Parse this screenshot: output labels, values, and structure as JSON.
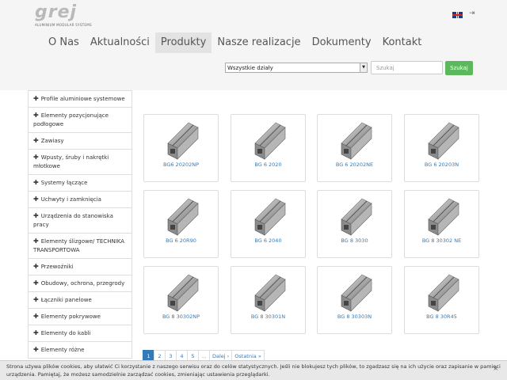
{
  "brand": {
    "logo_text": "grej",
    "logo_sub": "ALUMINIUM MODULAR SYSTEMS"
  },
  "nav": {
    "items": [
      "O Nas",
      "Aktualności",
      "Produkty",
      "Nasze realizacje",
      "Dokumenty",
      "Kontakt"
    ],
    "active": "Produkty"
  },
  "search": {
    "category": "Wszystkie działy",
    "placeholder": "Szukaj",
    "button": "Szukaj"
  },
  "sidebar": {
    "items": [
      "Profile aluminiowe systemowe",
      "Elementy pozycjonujące podłogowe",
      "Zawiasy",
      "Wpusty, śruby i nakrętki młotkowe",
      "Systemy łączące",
      "Uchwyty i zamknięcia",
      "Urządzenia do stanowiska pracy",
      "Elementy ślizgowe/ TECHNIKA TRANSPORTOWA",
      "Przewoźniki",
      "Obudowy, ochrona, przegrody",
      "Łączniki panelowe",
      "Elementy pokrywowe",
      "Elementy do kabli",
      "Elementy różne"
    ]
  },
  "products": [
    {
      "label": "BG6 20202NP",
      "icon": "aluminum-profile-icon"
    },
    {
      "label": "BG 6 2020",
      "icon": "aluminum-profile-icon"
    },
    {
      "label": "BG 6 20202NE",
      "icon": "aluminum-profile-icon"
    },
    {
      "label": "BG 6 20203N",
      "icon": "aluminum-profile-icon"
    },
    {
      "label": "BG 6 20R90",
      "icon": "aluminum-profile-icon"
    },
    {
      "label": "BG 6 2040",
      "icon": "aluminum-profile-icon"
    },
    {
      "label": "BG 8 3030",
      "icon": "aluminum-profile-icon"
    },
    {
      "label": "BG 8 30302 NE",
      "icon": "aluminum-profile-icon"
    },
    {
      "label": "BG 8 30302NP",
      "icon": "aluminum-profile-icon"
    },
    {
      "label": "BG 8 30301N",
      "icon": "aluminum-profile-icon"
    },
    {
      "label": "BG 8 30303N",
      "icon": "aluminum-profile-icon"
    },
    {
      "label": "BG 8 30R45",
      "icon": "aluminum-profile-icon"
    }
  ],
  "pagination": {
    "pages": [
      "1",
      "2",
      "3",
      "4",
      "5",
      "...",
      "Dalej ›",
      "Ostatnia »"
    ],
    "current": "1"
  },
  "cookie": {
    "text": "Strona używa plików cookies, aby ułatwić Ci korzystanie z naszego serwisu oraz do celów statystycznych. Jeśli nie blokujesz tych plików, to zgadzasz się na ich użycie oraz zapisanie w pamięci urządzenia. Pamiętaj, że możesz samodzielnie zarządzać cookies, zmieniając ustawienia przeglądarki.",
    "close": "×"
  },
  "colors": {
    "accent": "#337ab7",
    "button_green": "#5cb85c",
    "header_bg": "#f5f5f5"
  }
}
